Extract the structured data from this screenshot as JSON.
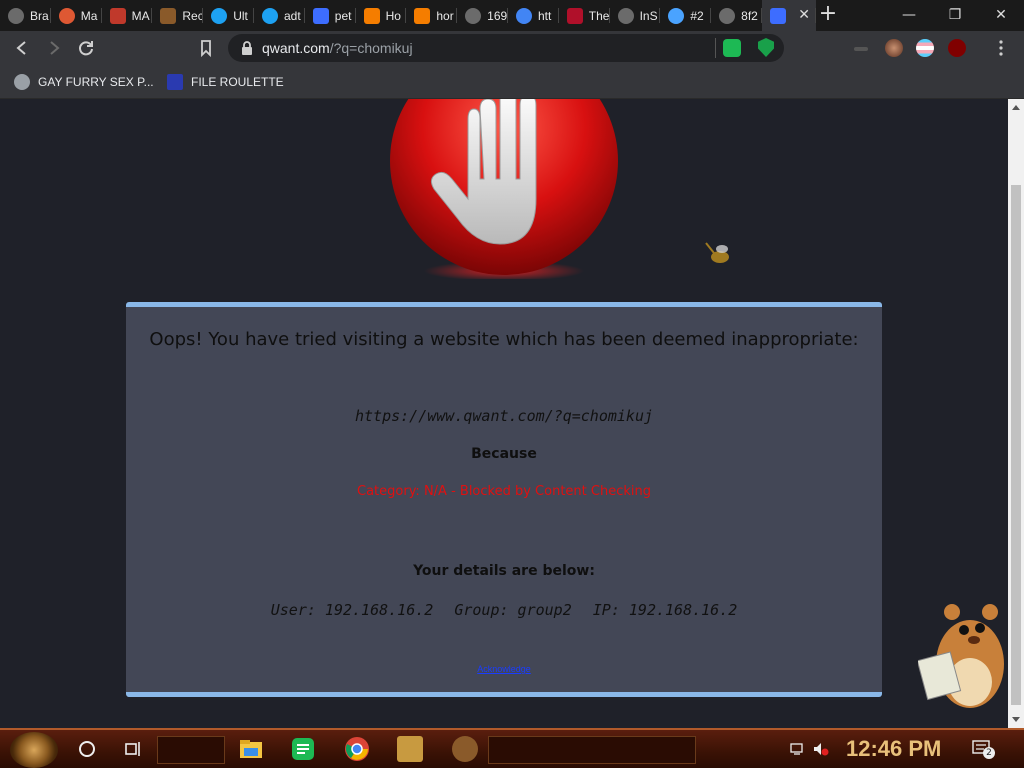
{
  "browser": {
    "tabs": [
      {
        "title": "Bra",
        "icon": "globe-icon",
        "color": "#6b6b6b"
      },
      {
        "title": "Ma",
        "icon": "duckduckgo-icon",
        "color": "#de5833"
      },
      {
        "title": "MA",
        "icon": "manga-icon",
        "color": "#c0392b"
      },
      {
        "title": "Rec",
        "icon": "p-icon",
        "color": "#8a5a2a"
      },
      {
        "title": "Ult",
        "icon": "twitter-icon",
        "color": "#1da1f2"
      },
      {
        "title": "adt",
        "icon": "twitter-icon",
        "color": "#1da1f2"
      },
      {
        "title": "pet",
        "icon": "qwant-icon",
        "color": "#3d6dff"
      },
      {
        "title": "Ho",
        "icon": "blogger-icon",
        "color": "#f57d00"
      },
      {
        "title": "hor",
        "icon": "blogger-icon",
        "color": "#f57d00"
      },
      {
        "title": "169",
        "icon": "globe-icon",
        "color": "#6b6b6b"
      },
      {
        "title": "htt",
        "icon": "google-icon",
        "color": "#4285f4"
      },
      {
        "title": "The",
        "icon": "m-icon",
        "color": "#b0102a"
      },
      {
        "title": "InS",
        "icon": "globe-icon",
        "color": "#6b6b6b"
      },
      {
        "title": "#2",
        "icon": "gear-icon",
        "color": "#4aa3ff"
      },
      {
        "title": "8f2",
        "icon": "globe-icon",
        "color": "#6b6b6b"
      },
      {
        "title": "",
        "icon": "qwant-icon",
        "color": "#3d6dff",
        "active": true
      }
    ],
    "new_tab_label": "+",
    "window": {
      "minimize": "—",
      "restore": "❐",
      "close": "✕"
    },
    "url_host": "qwant.com",
    "url_rest": "/?q=chomikuj",
    "bookmarks": [
      {
        "label": "GAY FURRY SEX P...",
        "icon": "globe-icon"
      },
      {
        "label": "FILE ROULETTE",
        "icon": "mf-icon"
      }
    ]
  },
  "block_page": {
    "heading": "Oops! You have tried visiting a website which has been deemed inappropriate:",
    "blocked_url": "https://www.qwant.com/?q=chomikuj",
    "because_label": "Because",
    "category": "Category: N/A - Blocked by Content Checking",
    "details_heading": "Your details are below:",
    "user": "User: 192.168.16.2",
    "group": "Group: group2",
    "ip": "IP: 192.168.16.2",
    "acknowledge": "Acknowledge"
  },
  "taskbar": {
    "clock": "12:46 PM",
    "notification_count": "2"
  },
  "colors": {
    "panel_border": "#8ab8e8",
    "category_red": "#e01010",
    "panel_bg": "#434756"
  }
}
